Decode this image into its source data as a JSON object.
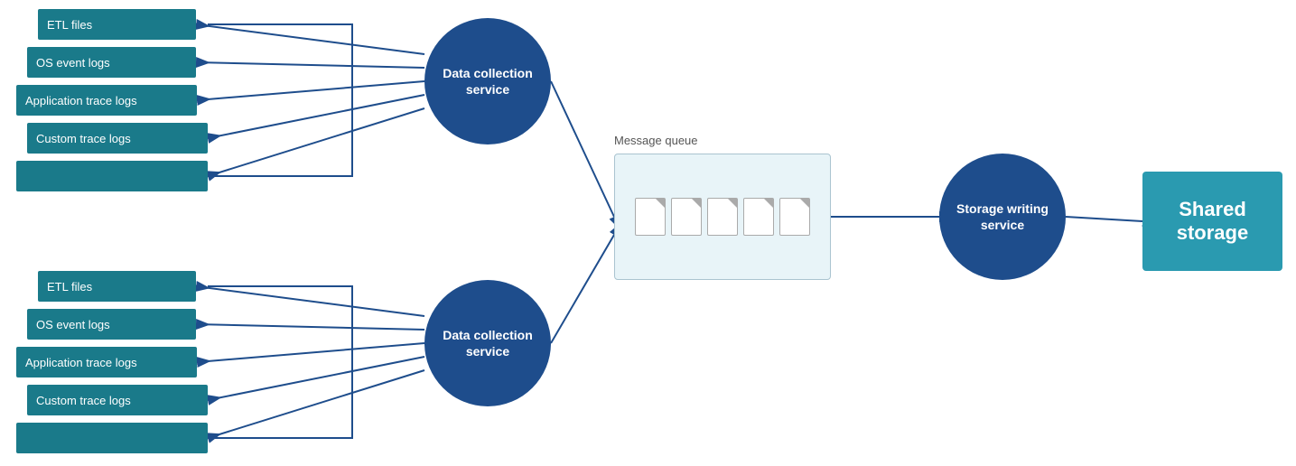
{
  "top_group": {
    "etl": "ETL files",
    "os": "OS event logs",
    "app": "Application trace logs",
    "custom": "Custom trace logs"
  },
  "bottom_group": {
    "etl": "ETL files",
    "os": "OS event logs",
    "app": "Application trace logs",
    "custom": "Custom trace logs"
  },
  "circles": {
    "collect_top": "Data collection service",
    "collect_bot": "Data collection service",
    "storage": "Storage writing service"
  },
  "mq": {
    "label": "Message queue"
  },
  "shared_storage": "Shared storage",
  "colors": {
    "teal_box": "#1a7a8a",
    "dark_blue_circle": "#1e4d8c",
    "arrow_blue": "#1e4d8c",
    "mq_border": "#aac4d0",
    "mq_bg": "#e8f4f8",
    "shared_storage_bg": "#2a9ab0"
  }
}
